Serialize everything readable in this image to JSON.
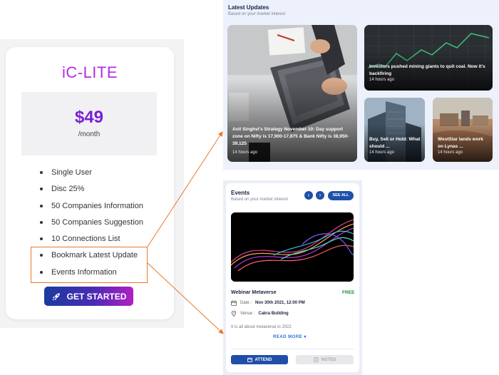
{
  "pricing": {
    "plan_name": "iC-LITE",
    "price": "$49",
    "period": "/month",
    "features": [
      "Single User",
      "Disc 25%",
      "50 Companies Information",
      "50 Companies Suggestion",
      "10 Connections List",
      "Bookmark Latest Update",
      "Events Information"
    ],
    "cta_label": "GET STARTED",
    "cta_icon": "rocket-icon",
    "accent_color": "#b12ee0",
    "highlight_color": "#e8792a"
  },
  "latest_updates": {
    "title": "Latest Updates",
    "subtitle": "Based on your market interest",
    "articles": [
      {
        "headline": "Anil Singhvi's Strategy November 10: Day support zone on Nifty is 17,900-17,875 & Bank Nifty is 38,950-39,125",
        "time": "14 hours ago"
      },
      {
        "headline": "Investors pushed mining giants to quit coal. Now it's backfiring",
        "time": "14 hours ago"
      },
      {
        "headline": "Buy, Sell or Hold: What should ...",
        "time": "14 hours ago"
      },
      {
        "headline": "WestStar lands work on Lynas ...",
        "time": "14 hours ago"
      }
    ]
  },
  "events": {
    "title": "Events",
    "subtitle": "Based on your market interest",
    "prev_icon": "chevron-left-icon",
    "next_icon": "chevron-right-icon",
    "see_all_label": "SEE ALL",
    "event_title": "Webinar Metaverse",
    "price_tag": "FREE",
    "date_label": "Date :",
    "date_value": "Nov 30th 2021, 12:00 PM",
    "venue_label": "Venue :",
    "venue_value": "Cakra Building",
    "description": "It is all about metaverse in 2022",
    "read_more_label": "READ MORE",
    "attend_label": "ATTEND",
    "notes_label": "NOTES",
    "primary_color": "#1f4fa8"
  }
}
